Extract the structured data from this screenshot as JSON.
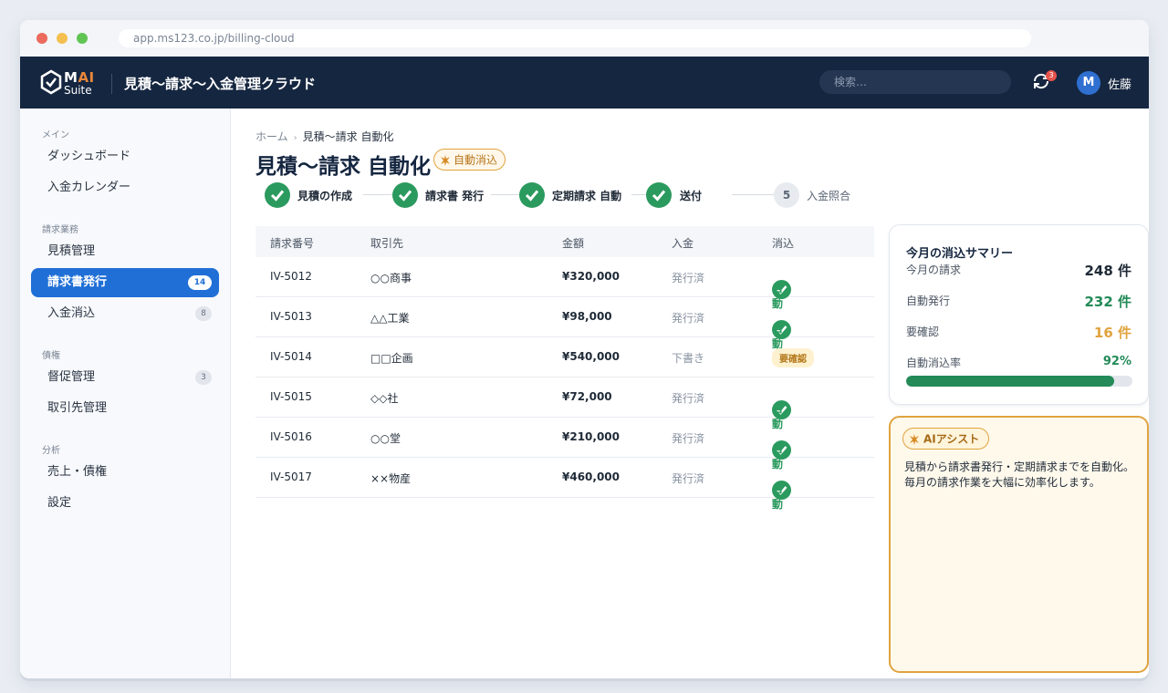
{
  "browser": {
    "url": "app.ms123.co.jp/billing-cloud"
  },
  "header": {
    "logo_text_1": "M",
    "logo_text_2": "AI",
    "logo_text_3": "Suite",
    "app_title": "見積〜請求〜入金管理クラウド",
    "search_placeholder": "検索…",
    "notification_count": "3",
    "avatar_initial": "M",
    "user_name": "佐藤"
  },
  "sidebar": {
    "sections": [
      {
        "label": "メイン"
      },
      {
        "label": "請求業務"
      },
      {
        "label": "債権"
      },
      {
        "label": "分析"
      }
    ],
    "items": [
      {
        "label": "ダッシュボード",
        "badge": ""
      },
      {
        "label": "入金カレンダー",
        "badge": ""
      },
      {
        "label": "見積管理",
        "badge": ""
      },
      {
        "label": "請求書発行",
        "badge": "14",
        "active": true
      },
      {
        "label": "入金消込",
        "badge": "8"
      },
      {
        "label": "督促管理",
        "badge": "3"
      },
      {
        "label": "取引先管理",
        "badge": ""
      },
      {
        "label": "売上・債権",
        "badge": ""
      },
      {
        "label": "設定",
        "badge": ""
      }
    ]
  },
  "breadcrumb": {
    "home": "ホーム",
    "separator": "›",
    "current": "見積〜請求 自動化"
  },
  "page": {
    "title": "見積〜請求 自動化",
    "badge": "自動消込"
  },
  "steps": [
    {
      "label": "見積の作成",
      "done": true
    },
    {
      "label": "請求書 発行",
      "done": true
    },
    {
      "label": "定期請求 自動",
      "done": true
    },
    {
      "label": "送付",
      "done": true
    },
    {
      "label": "入金照合",
      "number": "5",
      "done": false
    }
  ],
  "table": {
    "headers": [
      "請求番号",
      "取引先",
      "金額",
      "入金",
      "消込"
    ],
    "rows": [
      {
        "id": "IV-5012",
        "client": "○○商事",
        "amount": "¥320,000",
        "payment": "発行済",
        "status": "自動",
        "status_type": "ok"
      },
      {
        "id": "IV-5013",
        "client": "△△工業",
        "amount": "¥98,000",
        "payment": "発行済",
        "status": "自動",
        "status_type": "ok"
      },
      {
        "id": "IV-5014",
        "client": "□□企画",
        "amount": "¥540,000",
        "payment": "下書き",
        "status": "要確認",
        "status_type": "review"
      },
      {
        "id": "IV-5015",
        "client": "◇◇社",
        "amount": "¥72,000",
        "payment": "発行済",
        "status": "自動",
        "status_type": "ok"
      },
      {
        "id": "IV-5016",
        "client": "○○堂",
        "amount": "¥210,000",
        "payment": "発行済",
        "status": "自動",
        "status_type": "ok"
      },
      {
        "id": "IV-5017",
        "client": "××物産",
        "amount": "¥460,000",
        "payment": "発行済",
        "status": "自動",
        "status_type": "ok"
      }
    ]
  },
  "summary": {
    "title": "今月の消込サマリー",
    "rows": [
      {
        "label": "今月の請求",
        "value": "248 件",
        "color": "#1f2a37"
      },
      {
        "label": "自動発行",
        "value": "232 件",
        "color": "#238a58"
      },
      {
        "label": "要確認",
        "value": "16 件",
        "color": "#e0a33f"
      }
    ],
    "rate_label": "自動消込率",
    "rate_value": "92%",
    "rate_fraction": 0.92
  },
  "ai_assist": {
    "badge": "AIアシスト",
    "lines": [
      "見積から請求書発行・定期請求までを自動化。",
      "毎月の請求作業を大幅に効率化します。"
    ]
  },
  "colors": {
    "topbar": "#152640",
    "accent": "#1f6fd6",
    "success": "#2b9a5e",
    "warning": "#e0a33f"
  },
  "icons": {
    "logo": "hexagon-check-icon",
    "sync": "sync-icon",
    "step_done": "check-circle-icon",
    "badge": "sparkle-icon"
  }
}
